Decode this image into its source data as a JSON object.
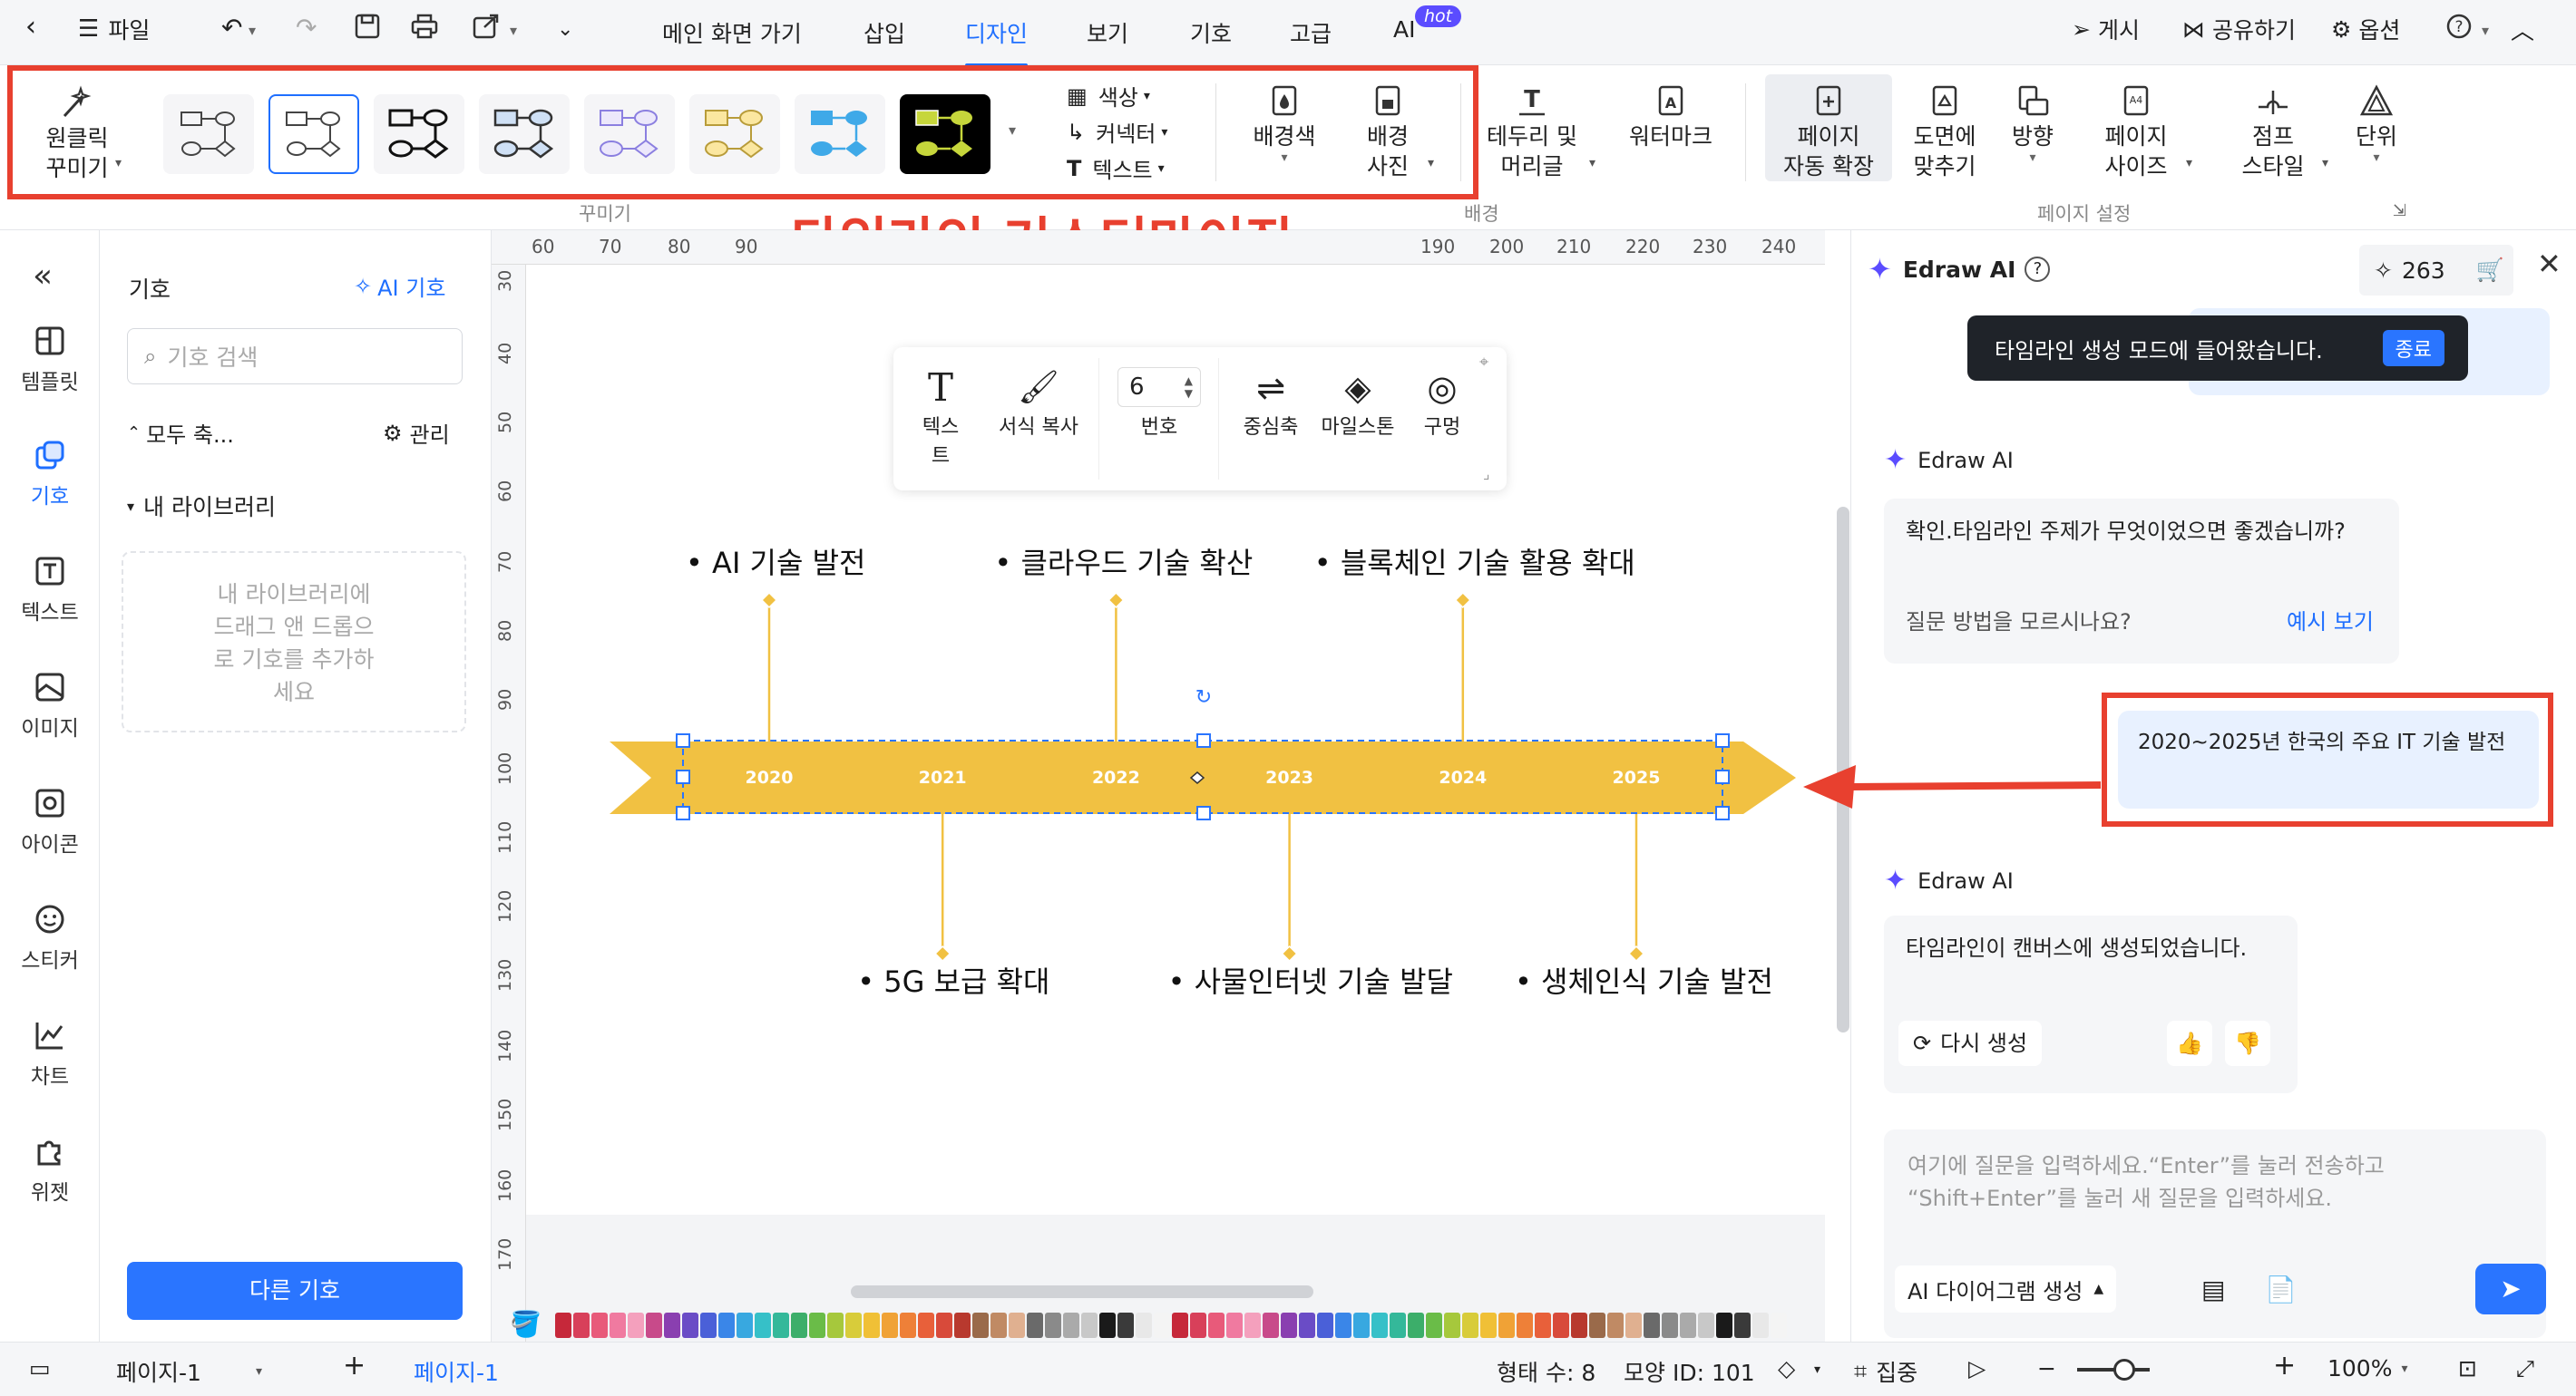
{
  "topbar": {
    "file": "파일",
    "menus": [
      "메인 화면 가기",
      "삽입",
      "디자인",
      "보기",
      "기호",
      "고급",
      "AI"
    ],
    "hot": "hot",
    "publish": "게시",
    "share": "공유하기",
    "options": "옵션"
  },
  "ribbon": {
    "oneclick": "원클릭\n꾸미기",
    "color": "색상",
    "connector": "커넥터",
    "text": "텍스트",
    "bgcolor": "배경색",
    "bgphoto": "배경\n사진",
    "border": "테두리 및\n머리글",
    "watermark": "워터마크",
    "autoexpand": "페이지\n자동 확장",
    "fit": "도면에\n맞추기",
    "orientation": "방향",
    "pagesize": "페이지\n사이즈",
    "jumpstyle": "점프\n스타일",
    "unit": "단위",
    "sec_decorate": "꾸미기",
    "sec_background": "배경",
    "sec_pagesetup": "페이지 설정"
  },
  "annotation": "타임라인 커스터마이징",
  "leftbar": [
    "템플릿",
    "기호",
    "텍스트",
    "이미지",
    "아이콘",
    "스티커",
    "차트",
    "위젯"
  ],
  "symbols": {
    "title": "기호",
    "ai": "AI 기호",
    "search_placeholder": "기호 검색",
    "collapse": "모두 축...",
    "manage": "관리",
    "mylib": "내 라이브러리",
    "drop_hint": "내 라이브러리에\n드래그 앤 드롭으\n로 기호를 추가하\n세요",
    "other": "다른 기호"
  },
  "ruler_top": [
    "60",
    "70",
    "80",
    "90",
    "190",
    "200",
    "210",
    "220",
    "230",
    "240"
  ],
  "ruler_left": [
    "30",
    "40",
    "50",
    "60",
    "70",
    "80",
    "90",
    "100",
    "110",
    "120",
    "130",
    "140",
    "150",
    "160",
    "170"
  ],
  "float_toolbar": {
    "text": "텍스트",
    "format": "서식 복사",
    "number_label": "번호",
    "number": "6",
    "axis": "중심축",
    "milestone": "마일스톤",
    "hole": "구멍"
  },
  "timeline": {
    "years": [
      "2020",
      "2021",
      "2022",
      "2023",
      "2024",
      "2025"
    ],
    "top_events": [
      "AI 기술 발전",
      "클라우드 기술 확산",
      "블록체인 기술 활용 확대"
    ],
    "bottom_events": [
      "5G 보급 확대",
      "사물인터넷 기술 발달",
      "생체인식 기술 발전"
    ]
  },
  "ai": {
    "title": "Edraw AI",
    "credits": "263",
    "toast": "타임라인 생성 모드에 들어왔습니다.",
    "toast_btn": "종료",
    "name": "Edraw AI",
    "msg1": "확인.타임라인 주제가 무엇이었으면 좋겠습니까?",
    "howto": "질문 방법을 모르시나요?",
    "example": "예시 보기",
    "user_msg": "2020~2025년 한국의 주요 IT 기술 발전",
    "msg2": "타임라인이 캔버스에 생성되었습니다.",
    "regen": "다시 생성",
    "input_placeholder": "여기에 질문을 입력하세요.“Enter”를 눌러 전송하고 “Shift+Enter”를 눌러 새 질문을 입력하세요.",
    "mode": "AI 다이어그램 생성"
  },
  "status": {
    "page_select": "페이지-1",
    "page_tab": "페이지-1",
    "shapes": "형태 수: 8",
    "shape_id": "모양 ID: 101",
    "focus": "집중",
    "zoom": "100%"
  },
  "colors": {
    "accent": "#1f6fff",
    "timeline": "#f1c142",
    "red": "#e8402f"
  }
}
